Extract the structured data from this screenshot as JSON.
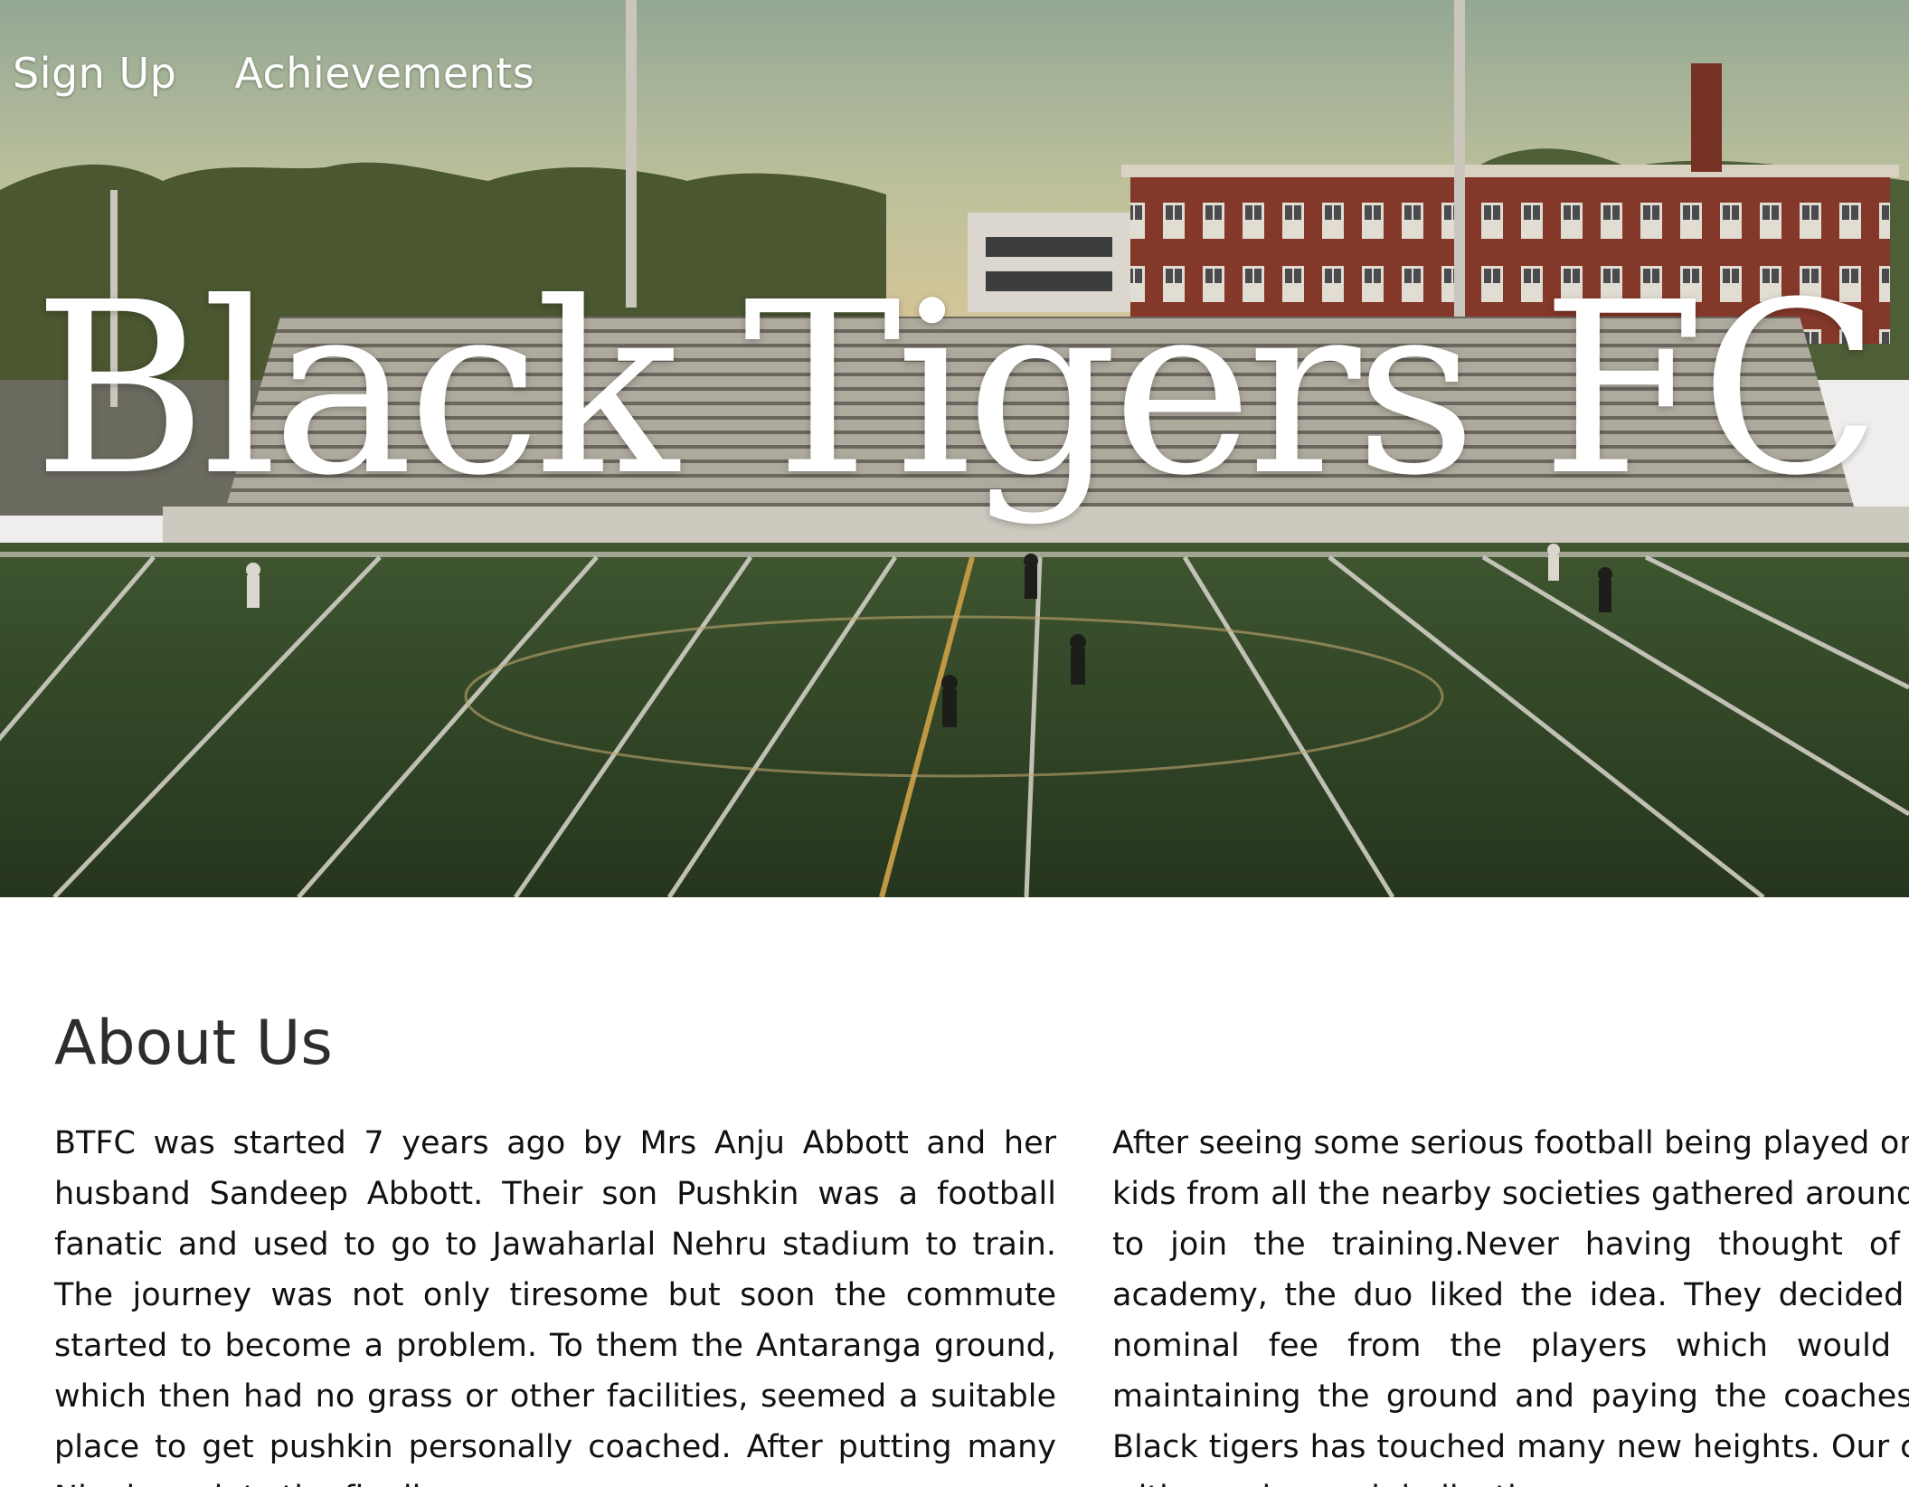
{
  "nav": {
    "items": [
      {
        "label": "Sign Up"
      },
      {
        "label": "Achievements"
      }
    ]
  },
  "hero": {
    "title": "Black Tigers FC",
    "background_image": "soccer-field-stadium-photo"
  },
  "about": {
    "heading": "About Us",
    "paragraph_left": "BTFC was started 7 years ago by Mrs Anju Abbott and her husband Sandeep Abbott. Their son Pushkin was a football fanatic and used to go to Jawaharlal Nehru stadium to train. The journey was not only tiresome but soon the commute started to become a problem. To them the Antaranga ground, which then had no grass or other facilities, seemed a suitable place to get pushkin personally coached. After putting many Ninaja sprints the finally",
    "paragraph_right": "After seeing some serious football being played on the ground, kids from all the nearby societies gathered around and wanted to join the training.Never having thought of starting an academy, the duo liked the idea. They decided to charge a nominal fee from the players which would go towards maintaining the ground and paying the coaches. Since then Black tigers has touched many new heights. Our coaches train with passion and dedication"
  },
  "colors": {
    "hero_text": "#ffffff",
    "heading_text": "#2d2d2d",
    "body_text": "#111111",
    "page_background": "#ffffff"
  }
}
